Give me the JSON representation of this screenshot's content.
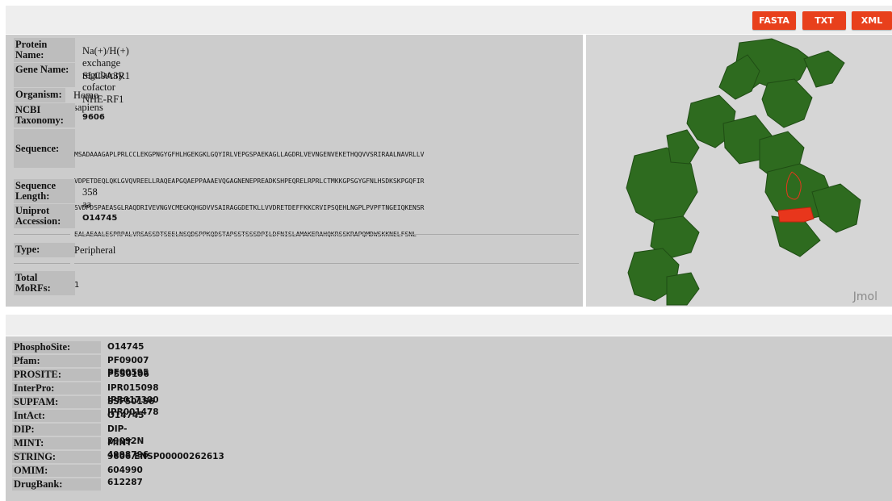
{
  "toolbar": {
    "fasta_label": "FASTA",
    "txt_label": "TXT",
    "xml_label": "XML",
    "button_color": "#e8401c"
  },
  "protein": {
    "name_label": "Protein Name:",
    "name": "Na(+)/H(+) exchange regulatory cofactor NHE-RF1",
    "gene_label": "Gene Name:",
    "gene": "SLC9A3R1",
    "organism_label": "Organism:",
    "organism": "Homo sapiens",
    "taxonomy_label": "NCBI Taxonomy:",
    "taxonomy": "9606",
    "sequence_label": "Sequence:",
    "sequence_lines": [
      "MSADAAAGAPLPRLCCLEKGPNGYGFHLHGEKGKLGQYIRLVEPGSPAEKAGLLAGDRLVEVNGENVEKETHQQVVSRIRAALNAVRLLV",
      "VDPETDEQLQKLGVQVREELLRAQEAPGQAEPPAAAEVQGAGNENEPREADKSHPEQRELRPRLCTMKKGPSGYGFNLHSDKSKPGQFIR",
      "SVDPDSPAEASGLRAQDRIVEVNGVCMEGKQHGDVVSAIRAGGDETKLLVVDRETDEFFKKCRVIPSQEHLNGPLPVPFTNGEIQKENSR",
      "EALAEAALESPRPALVRSASSDTSEELNSQDSPPKQDSTAPSSTSSSDPILDFNISLAMAKERAHQKRSSKRAPQMDWSKKNELFSNL"
    ],
    "length_label": "Sequence Length:",
    "length": "358 aa",
    "uniprot_label": "Uniprot Accession:",
    "uniprot": "O14745",
    "type_label": "Type:",
    "type": "Peripheral",
    "morfs_label": "Total MoRFs:",
    "morfs": "1"
  },
  "viewer": {
    "label": "Jmol",
    "protein_color": "#2e6b1f",
    "highlight_color": "#e8361c"
  },
  "links": [
    {
      "label": "PhosphoSite:",
      "value": "O14745"
    },
    {
      "label": "Pfam:",
      "value": "PF09007 PF00595"
    },
    {
      "label": "PROSITE:",
      "value": "PS50106"
    },
    {
      "label": "InterPro:",
      "value": "IPR015098 IPR017300 IPR001478"
    },
    {
      "label": "SUPFAM:",
      "value": "SSF50156"
    },
    {
      "label": "IntAct:",
      "value": "O14745"
    },
    {
      "label": "DIP:",
      "value": "DIP-29092N"
    },
    {
      "label": "MINT:",
      "value": "MINT-4998796"
    },
    {
      "label": "STRING:",
      "value": "9606.ENSP00000262613"
    },
    {
      "label": "OMIM:",
      "value": "604990 612287"
    },
    {
      "label": "DrugBank:",
      "value": ""
    }
  ]
}
